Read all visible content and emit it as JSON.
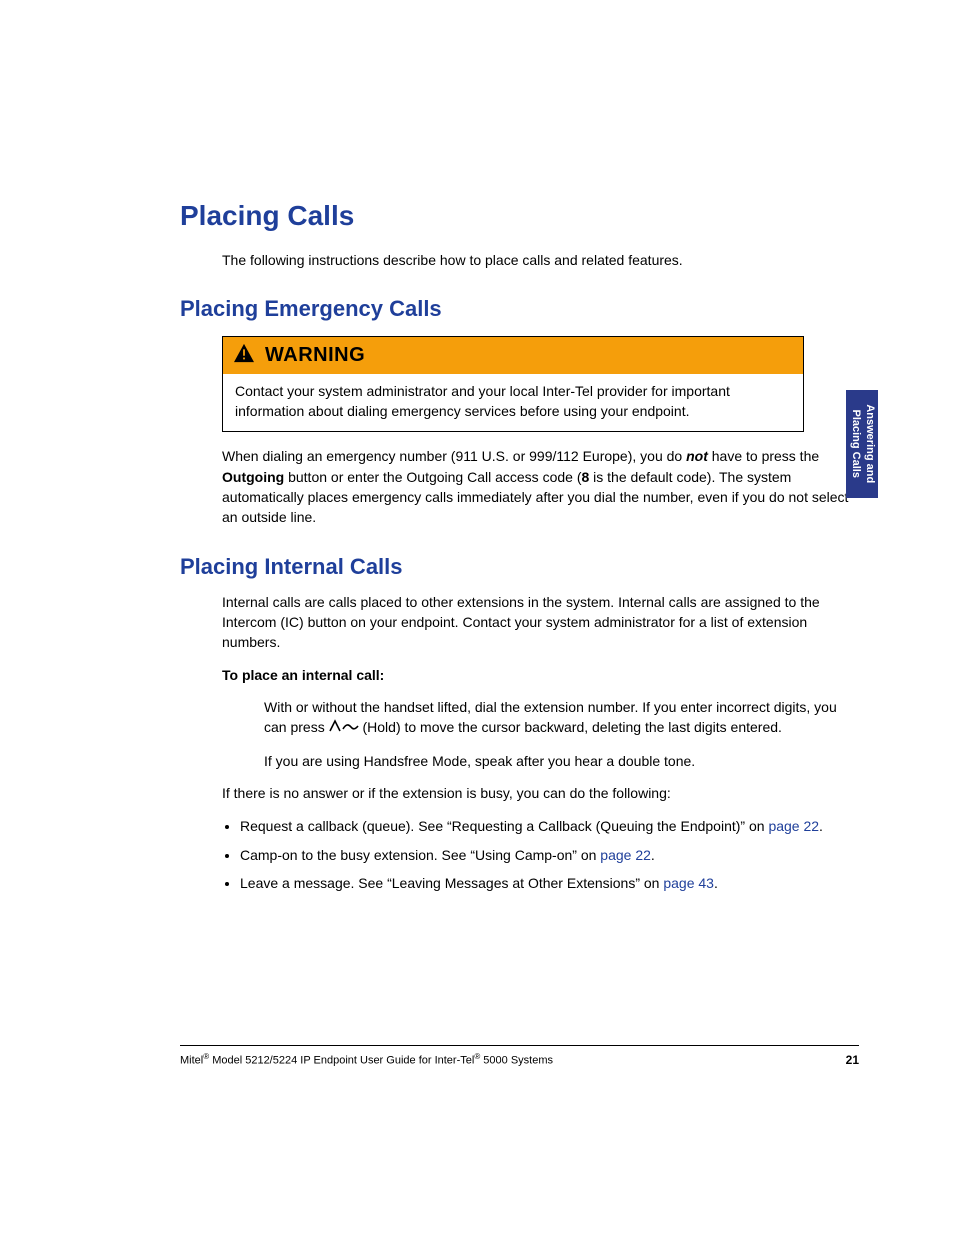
{
  "title": "Placing Calls",
  "intro": "The following instructions describe how to place calls and related features.",
  "sections": {
    "emergency": {
      "heading": "Placing Emergency Calls",
      "warning_label": "WARNING",
      "warning_body": "Contact your system administrator and your local Inter-Tel provider for important information about dialing emergency services before using your endpoint.",
      "para_parts": {
        "a": "When dialing an emergency number (911 U.S. or 999/112 Europe), you do ",
        "not": "not",
        "b": " have to press the ",
        "outgoing": "Outgoing",
        "c": " button or enter the Outgoing Call access code (",
        "code": "8",
        "d": " is the default code). The system automatically places emergency calls immediately after you dial the number, even if you do not select an outside line."
      }
    },
    "internal": {
      "heading": "Placing Internal Calls",
      "intro": "Internal calls are calls placed to other extensions in the system. Internal calls are assigned to the Intercom (IC) button on your endpoint. Contact your system administrator for a list of extension numbers.",
      "task_heading": "To place an internal call:",
      "step1_a": "With or without the handset lifted, dial the extension number. If you enter incorrect digits, you can press ",
      "step1_b": " (Hold) to move the cursor backward, deleting the last digits entered.",
      "step2": "If you are using Handsfree Mode, speak after you hear a double tone.",
      "noanswer": "If there is no answer or if the extension is busy, you can do the following:",
      "bullets": {
        "b1a": "Request a callback (queue). See “Requesting a Callback (Queuing the Endpoint)” on ",
        "b1link": "page 22",
        "b1b": ".",
        "b2a": "Camp-on to the busy extension. See “Using Camp-on” on ",
        "b2link": "page 22",
        "b2b": ".",
        "b3a": "Leave a message. See “Leaving Messages at Other Extensions” on ",
        "b3link": "page 43",
        "b3b": "."
      }
    }
  },
  "side_tab": {
    "line1": "Answering and",
    "line2": "Placing Calls"
  },
  "footer": {
    "brand": "Mitel",
    "reg1": "®",
    "mid": " Model 5212/5224 IP Endpoint User Guide for Inter-Tel",
    "reg2": "®",
    "tail": " 5000 Systems",
    "page": "21"
  }
}
